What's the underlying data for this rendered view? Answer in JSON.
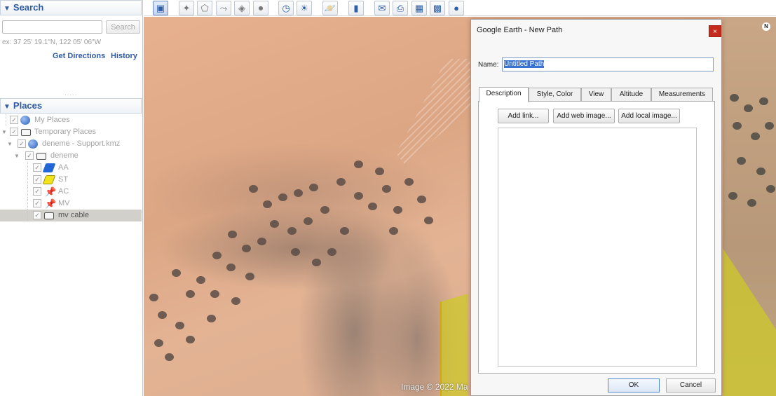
{
  "search": {
    "title": "Search",
    "query_value": "",
    "button_label": "Search",
    "hint": "ex: 37 25' 19.1\"N, 122 05' 06\"W",
    "get_directions": "Get Directions",
    "history": "History"
  },
  "places": {
    "title": "Places",
    "items": [
      {
        "label": "My Places",
        "checked": true,
        "icon": "globe-icon"
      },
      {
        "label": "Temporary Places",
        "checked": true,
        "icon": "folder-icon"
      },
      {
        "label": "deneme - Support.kmz",
        "checked": true,
        "icon": "globe-icon"
      },
      {
        "label": "deneme",
        "checked": true,
        "icon": "folder-icon"
      },
      {
        "label": "AA",
        "checked": true,
        "icon": "polygon-blue-icon"
      },
      {
        "label": "ST",
        "checked": true,
        "icon": "polygon-yellow-icon"
      },
      {
        "label": "AC",
        "checked": true,
        "icon": "pushpin-icon"
      },
      {
        "label": "MV",
        "checked": true,
        "icon": "pushpin-icon"
      },
      {
        "label": "mv cable",
        "checked": true,
        "icon": "folder-icon",
        "selected": true
      }
    ]
  },
  "map": {
    "copyright": "Image © 2022 Ma",
    "compass": "N"
  },
  "dialog": {
    "title": "Google Earth - New Path",
    "close": "×",
    "name_label": "Name:",
    "name_value": "Untitled Path",
    "tabs": [
      "Description",
      "Style, Color",
      "View",
      "Altitude",
      "Measurements"
    ],
    "active_tab": "Description",
    "add_link": "Add link...",
    "add_web_image": "Add web image...",
    "add_local_image": "Add local image...",
    "description_value": "",
    "ok": "OK",
    "cancel": "Cancel"
  },
  "colors": {
    "accent": "#2f5aa3",
    "selection": "#3a73d1",
    "close_button": "#c42b1c",
    "polygon_overlay": "#cec828"
  }
}
